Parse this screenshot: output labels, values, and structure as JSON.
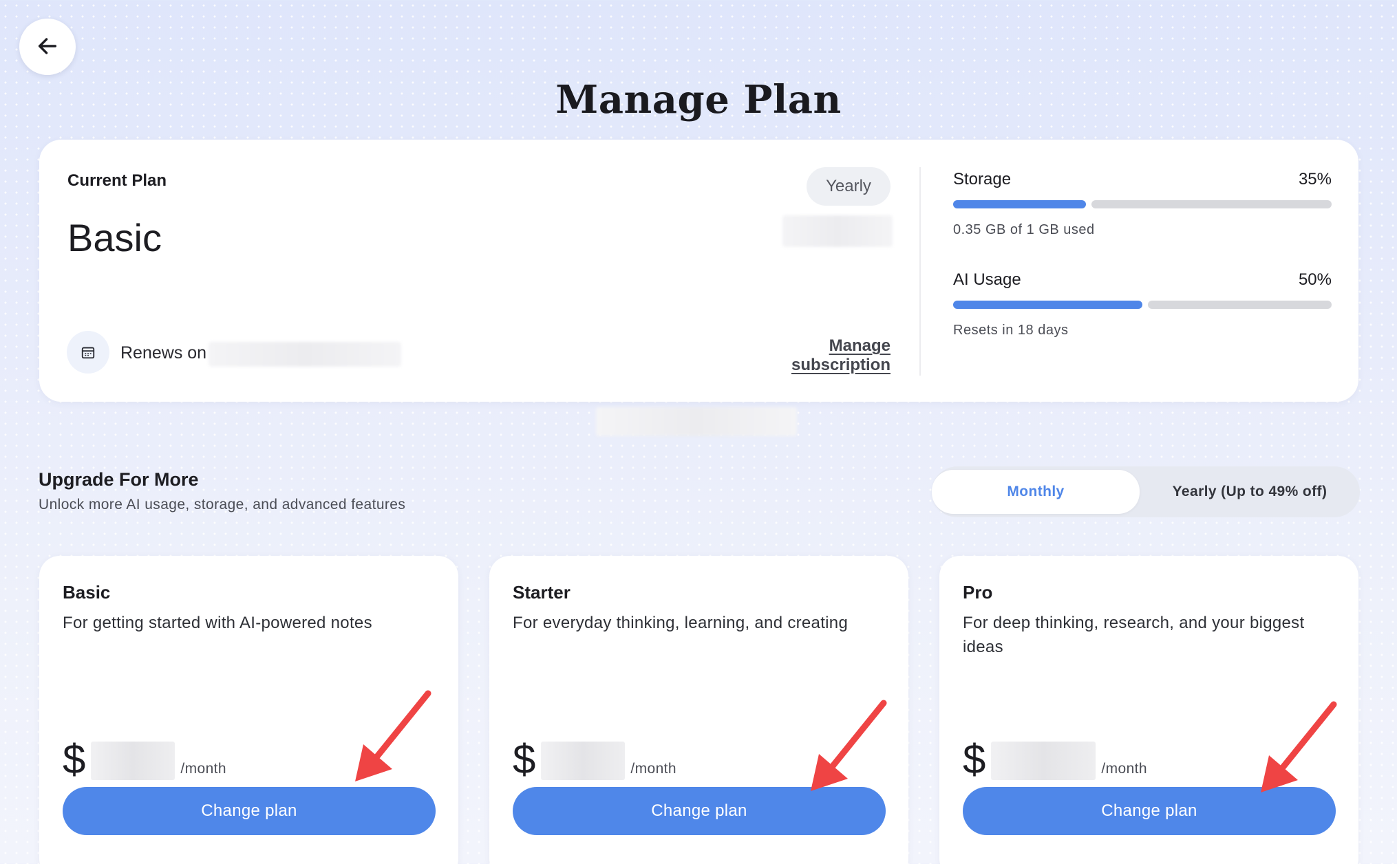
{
  "page": {
    "title": "Manage Plan"
  },
  "current_plan": {
    "label": "Current Plan",
    "name": "Basic",
    "billing_badge": "Yearly",
    "renews_label": "Renews on",
    "manage_link": "Manage subscription"
  },
  "usage": {
    "storage": {
      "label": "Storage",
      "percent_text": "35%",
      "fraction": 0.35,
      "detail": "0.35 GB of 1 GB used"
    },
    "ai": {
      "label": "AI Usage",
      "percent_text": "50%",
      "fraction": 0.5,
      "detail": "Resets in 18 days"
    }
  },
  "upgrade": {
    "title": "Upgrade For More",
    "subtitle": "Unlock more AI usage, storage, and advanced features",
    "toggle": {
      "monthly": "Monthly",
      "yearly": "Yearly (Up to 49% off)",
      "selected": "monthly"
    }
  },
  "plans": [
    {
      "name": "Basic",
      "description": "For getting started with AI-powered notes",
      "currency": "$",
      "period": "/month",
      "button": "Change plan"
    },
    {
      "name": "Starter",
      "description": "For everyday thinking, learning, and creating",
      "currency": "$",
      "period": "/month",
      "button": "Change plan"
    },
    {
      "name": "Pro",
      "description": "For deep thinking, research, and your biggest ideas",
      "currency": "$",
      "period": "/month",
      "button": "Change plan"
    }
  ],
  "colors": {
    "accent": "#4f87e9",
    "bar_track": "#d7d8dc",
    "annotation_arrow": "#ef4444"
  },
  "icons": {
    "back": "arrow-left-icon",
    "calendar": "calendar-icon"
  }
}
